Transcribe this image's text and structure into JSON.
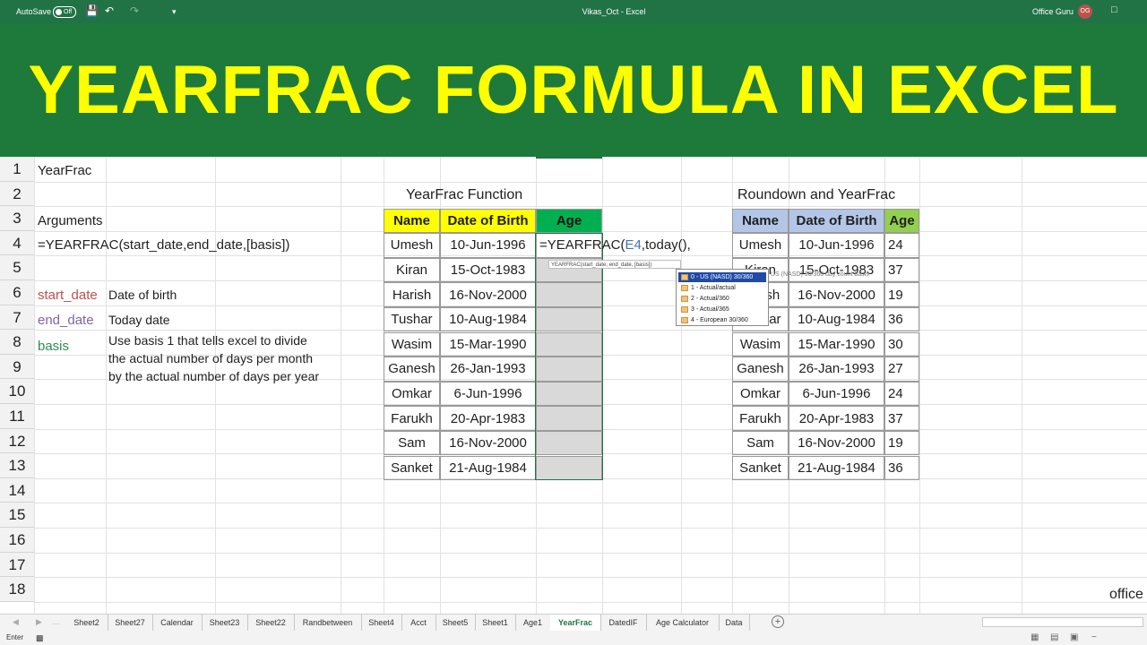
{
  "titlebar": {
    "autosave_label": "AutoSave",
    "autosave_state": "Off",
    "doc_title": "Vikas_Oct  -  Excel",
    "user_name": "Office Guru",
    "user_initials": "OG",
    "bg_color": "#217346"
  },
  "banner": {
    "title": "YEARFRAC FORMULA IN EXCEL",
    "bg_color": "#1d7a3a",
    "text_color": "#ffff00"
  },
  "rows": [
    "1",
    "2",
    "3",
    "4",
    "5",
    "6",
    "7",
    "8",
    "9",
    "10",
    "11",
    "12",
    "13",
    "14",
    "15",
    "16",
    "17",
    "18"
  ],
  "notes": {
    "a1": "YearFrac",
    "a3": "Arguments",
    "a4": "=YEARFRAC(start_date,end_date,[basis])",
    "start_date_label": "start_date",
    "start_date_desc": "Date of birth",
    "end_date_label": "end_date",
    "end_date_desc": "Today date",
    "basis_label": "basis",
    "basis_desc_1": "Use basis 1 that tells excel to divide",
    "basis_desc_2": "the actual number of days per month",
    "basis_desc_3": "by the actual number of days per year"
  },
  "table1": {
    "title": "YearFrac Function",
    "headers": [
      "Name",
      "Date of Birth",
      "Age"
    ],
    "rows": [
      {
        "name": "Umesh",
        "dob": "10-Jun-1996"
      },
      {
        "name": "Kiran",
        "dob": "15-Oct-1983"
      },
      {
        "name": "Harish",
        "dob": "16-Nov-2000"
      },
      {
        "name": "Tushar",
        "dob": "10-Aug-1984"
      },
      {
        "name": "Wasim",
        "dob": "15-Mar-1990"
      },
      {
        "name": "Ganesh",
        "dob": "26-Jan-1993"
      },
      {
        "name": "Omkar",
        "dob": "6-Jun-1996"
      },
      {
        "name": "Farukh",
        "dob": "20-Apr-1983"
      },
      {
        "name": "Sam",
        "dob": "16-Nov-2000"
      },
      {
        "name": "Sanket",
        "dob": "21-Aug-1984"
      }
    ],
    "editing_formula": {
      "prefix": "=YEARFRAC(",
      "ref": "E4",
      "rest": ",today()",
      "suffix": ","
    }
  },
  "tooltip": {
    "signature": "YEARFRAC(start_date, end_date, [basis])",
    "basis_hint": "US (NASD) 30/360 day count basis"
  },
  "basis_options": [
    "0 - US (NASD) 30/360",
    "1 - Actual/actual",
    "2 - Actual/360",
    "3 - Actual/365",
    "4 - European 30/360"
  ],
  "table2": {
    "title": "Roundown and YearFrac",
    "headers": [
      "Name",
      "Date of Birth",
      "Age"
    ],
    "rows": [
      {
        "name": "Umesh",
        "dob": "10-Jun-1996",
        "age": "24"
      },
      {
        "name": "Kiran",
        "dob": "15-Oct-1983",
        "age": "37"
      },
      {
        "name": "Harish",
        "dob": "16-Nov-2000",
        "age": "19"
      },
      {
        "name": "Tushar",
        "dob": "10-Aug-1984",
        "age": "36"
      },
      {
        "name": "Wasim",
        "dob": "15-Mar-1990",
        "age": "30"
      },
      {
        "name": "Ganesh",
        "dob": "26-Jan-1993",
        "age": "27"
      },
      {
        "name": "Omkar",
        "dob": "6-Jun-1996",
        "age": "24"
      },
      {
        "name": "Farukh",
        "dob": "20-Apr-1983",
        "age": "37"
      },
      {
        "name": "Sam",
        "dob": "16-Nov-2000",
        "age": "19"
      },
      {
        "name": "Sanket",
        "dob": "21-Aug-1984",
        "age": "36"
      }
    ]
  },
  "watermark": "office",
  "tabs": [
    "Sheet2",
    "Sheet27",
    "Calendar",
    "Sheet23",
    "Sheet22",
    "Randbetween",
    "Sheet4",
    "Acct",
    "Sheet5",
    "Sheet1",
    "Age1",
    "YearFrac",
    "DatedIF",
    "Age Calculator",
    "Data"
  ],
  "active_tab": "YearFrac",
  "status": {
    "mode": "Enter"
  }
}
